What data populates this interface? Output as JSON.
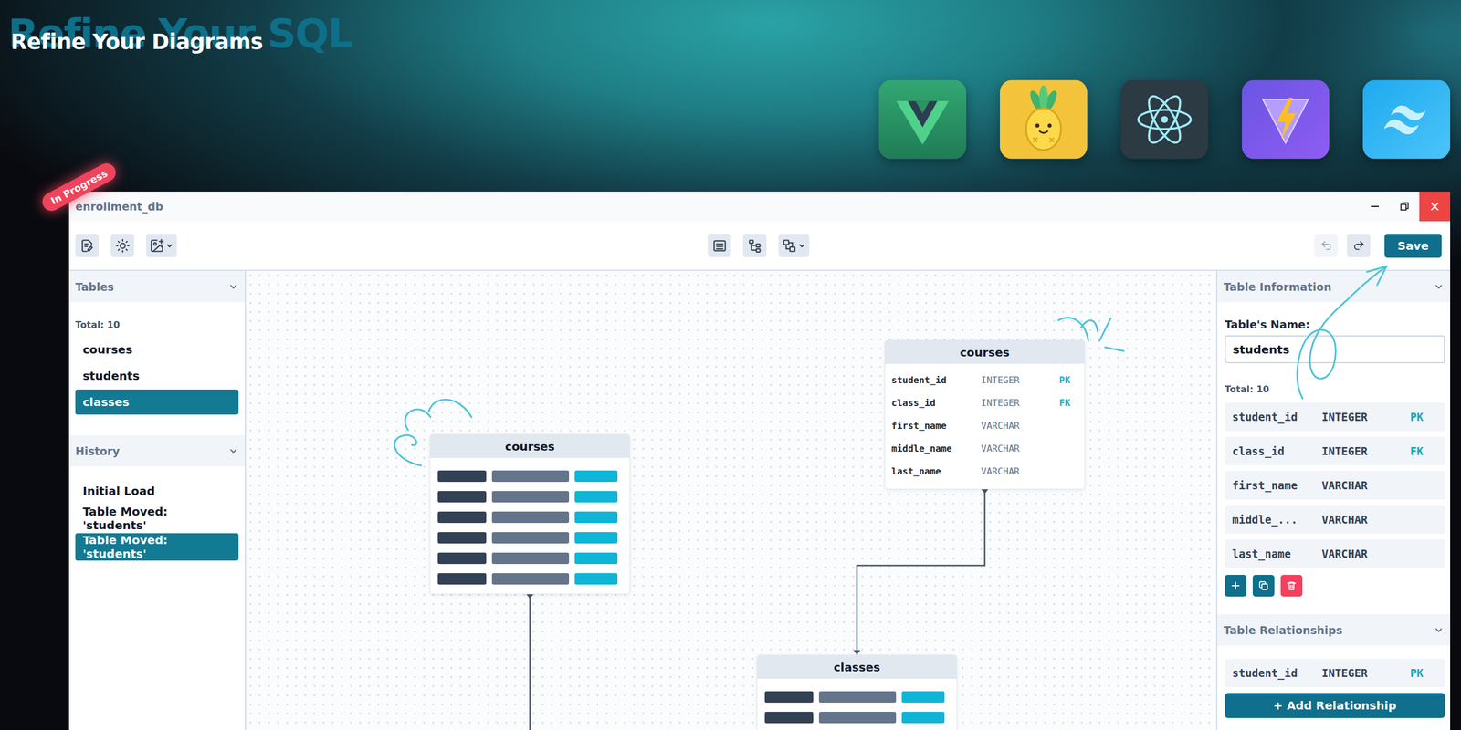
{
  "hero": {
    "title": "Refine Your Diagrams",
    "backdrop": "Refine Your SQL",
    "badge": "In Progress"
  },
  "window": {
    "title": "enrollment_db",
    "close": "×"
  },
  "toolbar": {
    "undo": {
      "disabled": true
    },
    "redo": {
      "disabled": false
    },
    "save": "Save"
  },
  "tables_panel": {
    "title": "Tables",
    "expanded": true,
    "total": "Total: 10",
    "items": [
      {
        "label": "courses",
        "selected": false
      },
      {
        "label": "students",
        "selected": false
      },
      {
        "label": "classes",
        "selected": true
      }
    ]
  },
  "history_panel": {
    "title": "History",
    "expanded": true,
    "items": [
      {
        "label": "Initial Load",
        "selected": false
      },
      {
        "label": "Table Moved: 'students'",
        "selected": false
      },
      {
        "label": "Table Moved: 'students'",
        "selected": true
      }
    ]
  },
  "canvas": {
    "nodes": [
      {
        "title": "courses",
        "kind": "skeleton",
        "placeholder_rows": 6
      },
      {
        "title": "courses",
        "kind": "detailed",
        "columns": [
          {
            "name": "student_id",
            "type": "INTEGER",
            "key": "PK"
          },
          {
            "name": "class_id",
            "type": "INTEGER",
            "key": "FK"
          },
          {
            "name": "first_name",
            "type": "VARCHAR"
          },
          {
            "name": "middle_name",
            "type": "VARCHAR"
          },
          {
            "name": "last_name",
            "type": "VARCHAR"
          }
        ]
      },
      {
        "title": "classes",
        "kind": "skeleton",
        "placeholder_rows": 2
      }
    ],
    "edges": [
      {
        "from": 1,
        "to": 2
      },
      {
        "from": 0,
        "to": null
      }
    ]
  },
  "info_panel": {
    "title": "Table Information",
    "expanded": true,
    "name_label": "Table's Name:",
    "name_value": "students",
    "total": "Total: 10",
    "columns": [
      {
        "name": "student_id",
        "type": "INTEGER",
        "key": "PK"
      },
      {
        "name": "class_id",
        "type": "INTEGER",
        "key": "FK"
      },
      {
        "name": "first_name",
        "type": "VARCHAR"
      },
      {
        "name": "middle_...",
        "type": "VARCHAR"
      },
      {
        "name": "last_name",
        "type": "VARCHAR"
      }
    ]
  },
  "relationships_panel": {
    "title": "Table Relationships",
    "expanded": true,
    "rows": [
      {
        "name": "student_id",
        "type": "INTEGER",
        "key": "PK"
      }
    ],
    "add_button": "+ Add Relationship"
  }
}
